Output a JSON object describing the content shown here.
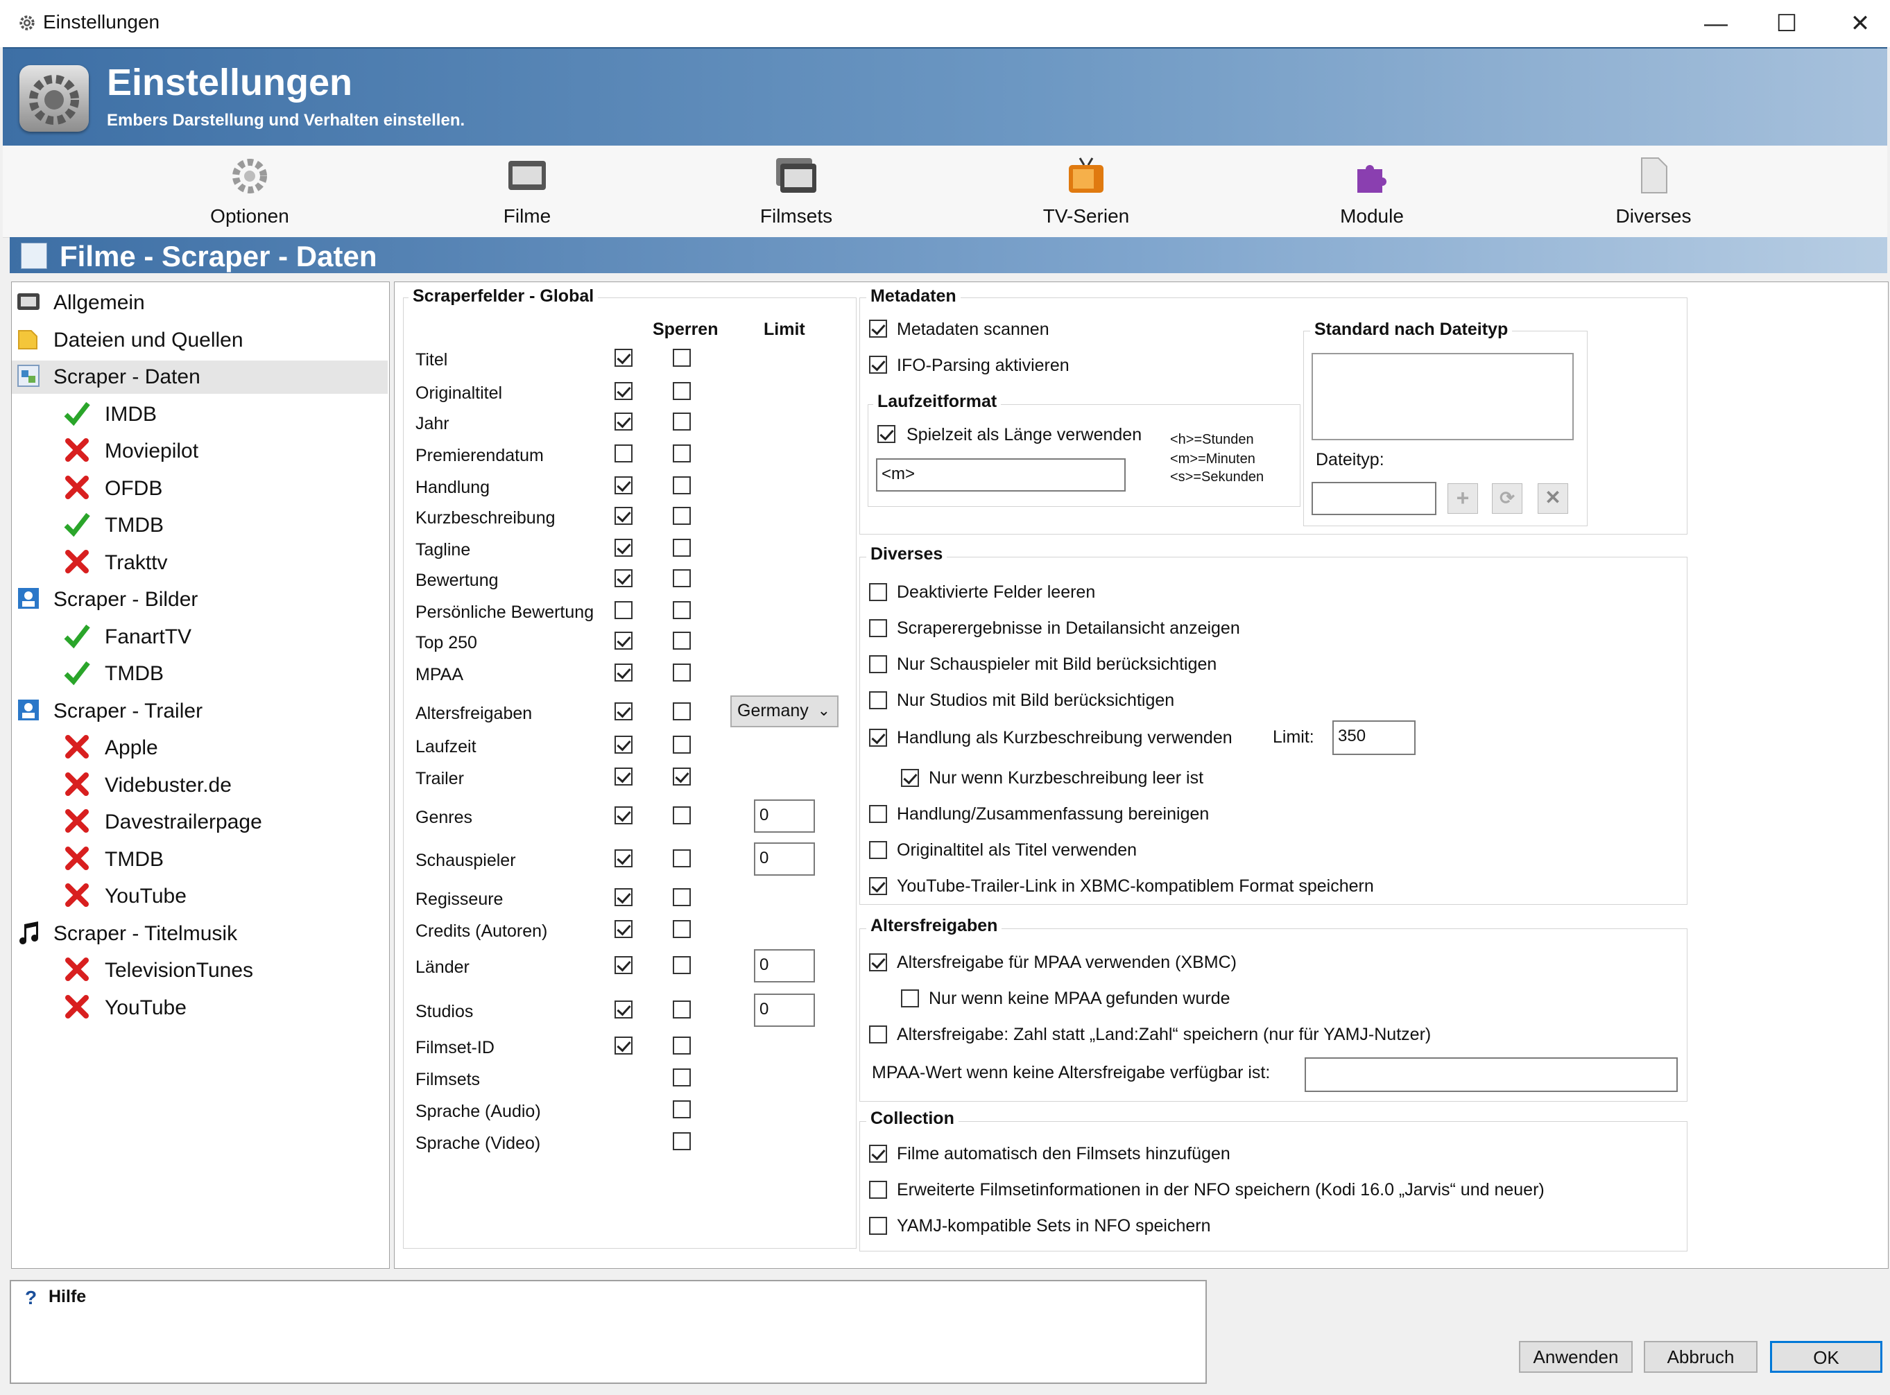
{
  "window": {
    "title": "Einstellungen",
    "minimize": "—",
    "maximize": "☐",
    "close": "✕"
  },
  "banner": {
    "title": "Einstellungen",
    "subtitle": "Embers Darstellung und Verhalten einstellen."
  },
  "toolbar": {
    "items": [
      {
        "label": "Optionen",
        "icon": "gear-icon"
      },
      {
        "label": "Filme",
        "icon": "film-icon"
      },
      {
        "label": "Filmsets",
        "icon": "filmset-icon"
      },
      {
        "label": "TV-Serien",
        "icon": "tv-icon"
      },
      {
        "label": "Module",
        "icon": "puzzle-icon"
      },
      {
        "label": "Diverses",
        "icon": "document-icon"
      }
    ]
  },
  "section": {
    "title": "Filme - Scraper - Daten"
  },
  "tree": {
    "items": [
      {
        "label": "Allgemein",
        "icon": "film-icon",
        "level": 0,
        "status": ""
      },
      {
        "label": "Dateien und Quellen",
        "icon": "folder-icon",
        "level": 0,
        "status": ""
      },
      {
        "label": "Scraper - Daten",
        "icon": "scraper-data-icon",
        "level": 0,
        "status": "",
        "selected": true
      },
      {
        "label": "IMDB",
        "icon": "",
        "level": 1,
        "status": "enabled"
      },
      {
        "label": "Moviepilot",
        "icon": "",
        "level": 1,
        "status": "disabled"
      },
      {
        "label": "OFDB",
        "icon": "",
        "level": 1,
        "status": "disabled"
      },
      {
        "label": "TMDB",
        "icon": "",
        "level": 1,
        "status": "enabled"
      },
      {
        "label": "Trakttv",
        "icon": "",
        "level": 1,
        "status": "disabled"
      },
      {
        "label": "Scraper - Bilder",
        "icon": "image-icon",
        "level": 0,
        "status": ""
      },
      {
        "label": "FanartTV",
        "icon": "",
        "level": 1,
        "status": "enabled"
      },
      {
        "label": "TMDB",
        "icon": "",
        "level": 1,
        "status": "enabled"
      },
      {
        "label": "Scraper - Trailer",
        "icon": "image-icon",
        "level": 0,
        "status": ""
      },
      {
        "label": "Apple",
        "icon": "",
        "level": 1,
        "status": "disabled"
      },
      {
        "label": "Videbuster.de",
        "icon": "",
        "level": 1,
        "status": "disabled"
      },
      {
        "label": "Davestrailerpage",
        "icon": "",
        "level": 1,
        "status": "disabled"
      },
      {
        "label": "TMDB",
        "icon": "",
        "level": 1,
        "status": "disabled"
      },
      {
        "label": "YouTube",
        "icon": "",
        "level": 1,
        "status": "disabled"
      },
      {
        "label": "Scraper - Titelmusik",
        "icon": "music-icon",
        "level": 0,
        "status": ""
      },
      {
        "label": "TelevisionTunes",
        "icon": "",
        "level": 1,
        "status": "disabled"
      },
      {
        "label": "YouTube",
        "icon": "",
        "level": 1,
        "status": "disabled"
      }
    ]
  },
  "scraperfelder": {
    "legend": "Scraperfelder - Global",
    "col_sperren": "Sperren",
    "col_limit": "Limit",
    "rows": [
      {
        "label": "Titel",
        "enabled": true,
        "locked": false,
        "limit": null
      },
      {
        "label": "Originaltitel",
        "enabled": true,
        "locked": false,
        "limit": null
      },
      {
        "label": "Jahr",
        "enabled": true,
        "locked": false,
        "limit": null
      },
      {
        "label": "Premierendatum",
        "enabled": false,
        "locked": false,
        "limit": null
      },
      {
        "label": "Handlung",
        "enabled": true,
        "locked": false,
        "limit": null
      },
      {
        "label": "Kurzbeschreibung",
        "enabled": true,
        "locked": false,
        "limit": null
      },
      {
        "label": "Tagline",
        "enabled": true,
        "locked": false,
        "limit": null
      },
      {
        "label": "Bewertung",
        "enabled": true,
        "locked": false,
        "limit": null
      },
      {
        "label": "Persönliche Bewertung",
        "enabled": false,
        "locked": false,
        "limit": null
      },
      {
        "label": "Top 250",
        "enabled": true,
        "locked": false,
        "limit": null
      },
      {
        "label": "MPAA",
        "enabled": true,
        "locked": false,
        "limit": null
      },
      {
        "label": "Altersfreigaben",
        "enabled": true,
        "locked": false,
        "limit": null,
        "dropdown": "Germany"
      },
      {
        "label": "Laufzeit",
        "enabled": true,
        "locked": false,
        "limit": null
      },
      {
        "label": "Trailer",
        "enabled": true,
        "locked": true,
        "limit": null
      },
      {
        "label": "Genres",
        "enabled": true,
        "locked": false,
        "limit": "0"
      },
      {
        "label": "Schauspieler",
        "enabled": true,
        "locked": false,
        "limit": "0"
      },
      {
        "label": "Regisseure",
        "enabled": true,
        "locked": false,
        "limit": null
      },
      {
        "label": "Credits (Autoren)",
        "enabled": true,
        "locked": false,
        "limit": null
      },
      {
        "label": "Länder",
        "enabled": true,
        "locked": false,
        "limit": "0"
      },
      {
        "label": "Studios",
        "enabled": true,
        "locked": false,
        "limit": "0"
      },
      {
        "label": "Filmset-ID",
        "enabled": true,
        "locked": false,
        "limit": null
      },
      {
        "label": "Filmsets",
        "enabled": null,
        "locked": false,
        "limit": null
      },
      {
        "label": "Sprache (Audio)",
        "enabled": null,
        "locked": false,
        "limit": null
      },
      {
        "label": "Sprache (Video)",
        "enabled": null,
        "locked": false,
        "limit": null
      }
    ]
  },
  "metadaten": {
    "legend": "Metadaten",
    "scan": {
      "label": "Metadaten scannen",
      "checked": true
    },
    "ifo": {
      "label": "IFO-Parsing aktivieren",
      "checked": true
    },
    "laufzeitformat": {
      "legend": "Laufzeitformat",
      "spielzeit": {
        "label": "Spielzeit als Länge verwenden",
        "checked": true
      },
      "format_value": "<m>",
      "help_h": "<h>=Stunden",
      "help_m": "<m>=Minuten",
      "help_s": "<s>=Sekunden"
    },
    "standard": {
      "legend": "Standard nach Dateityp",
      "dateityp_label": "Dateityp:",
      "dateityp_value": "",
      "add": "+",
      "edit": "⟳",
      "remove": "✕"
    }
  },
  "diverses": {
    "legend": "Diverses",
    "items": [
      {
        "label": "Deaktivierte Felder leeren",
        "checked": false
      },
      {
        "label": "Scraperergebnisse in Detailansicht anzeigen",
        "checked": false
      },
      {
        "label": "Nur Schauspieler mit Bild berücksichtigen",
        "checked": false
      },
      {
        "label": "Nur Studios mit Bild berücksichtigen",
        "checked": false
      },
      {
        "label": "Handlung als Kurzbeschreibung verwenden",
        "checked": true
      },
      {
        "label": "Nur wenn Kurzbeschreibung leer ist",
        "checked": true
      },
      {
        "label": "Handlung/Zusammenfassung bereinigen",
        "checked": false
      },
      {
        "label": "Originaltitel als Titel verwenden",
        "checked": false
      },
      {
        "label": "YouTube-Trailer-Link in XBMC-kompatiblem Format speichern",
        "checked": true
      }
    ],
    "limit_label": "Limit:",
    "limit_value": "350"
  },
  "altersfreigaben": {
    "legend": "Altersfreigaben",
    "items": [
      {
        "label": "Altersfreigabe für MPAA verwenden (XBMC)",
        "checked": true
      },
      {
        "label": "Nur wenn keine MPAA gefunden wurde",
        "checked": false
      },
      {
        "label": "Altersfreigabe: Zahl statt „Land:Zahl“ speichern (nur für YAMJ-Nutzer)",
        "checked": false
      }
    ],
    "mpaa_label": "MPAA-Wert wenn keine Altersfreigabe verfügbar ist:",
    "mpaa_value": ""
  },
  "collection": {
    "legend": "Collection",
    "items": [
      {
        "label": "Filme automatisch den Filmsets hinzufügen",
        "checked": true
      },
      {
        "label": "Erweiterte Filmsetinformationen in der NFO speichern (Kodi 16.0 „Jarvis“ und neuer)",
        "checked": false
      },
      {
        "label": "YAMJ-kompatible Sets in NFO speichern",
        "checked": false
      }
    ]
  },
  "help": {
    "icon": "?",
    "title": "Hilfe"
  },
  "buttons": {
    "apply": "Anwenden",
    "cancel": "Abbruch",
    "ok": "OK"
  }
}
